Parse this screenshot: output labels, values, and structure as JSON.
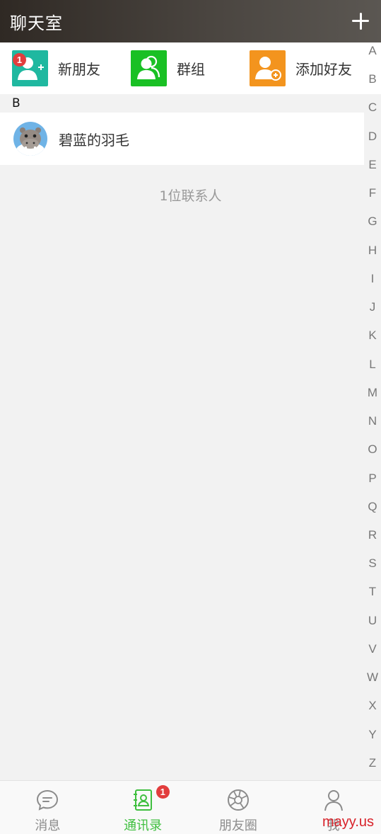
{
  "header": {
    "title": "聊天室",
    "add_icon": "plus-icon"
  },
  "shortcuts": [
    {
      "label": "新朋友",
      "icon": "new-friend-icon",
      "color": "#1fb8a0",
      "badge": "1"
    },
    {
      "label": "群组",
      "icon": "group-icon",
      "color": "#19c024"
    },
    {
      "label": "添加好友",
      "icon": "add-friend-icon",
      "color": "#f3941e"
    }
  ],
  "section": {
    "letter": "B"
  },
  "contacts": [
    {
      "name": "碧蓝的羽毛",
      "avatar": "hippo-avatar"
    }
  ],
  "contact_count": "1位联系人",
  "index_letters": [
    "A",
    "B",
    "C",
    "D",
    "E",
    "F",
    "G",
    "H",
    "I",
    "J",
    "K",
    "L",
    "M",
    "N",
    "O",
    "P",
    "Q",
    "R",
    "S",
    "T",
    "U",
    "V",
    "W",
    "X",
    "Y",
    "Z"
  ],
  "tabs": [
    {
      "label": "消息",
      "icon": "chat-icon",
      "active": false
    },
    {
      "label": "通讯录",
      "icon": "contacts-icon",
      "active": true,
      "badge": "1"
    },
    {
      "label": "朋友圈",
      "icon": "moments-icon",
      "active": false
    },
    {
      "label": "我",
      "icon": "profile-icon",
      "active": false
    }
  ],
  "watermark": "mayy.us",
  "colors": {
    "accent": "#3fbf3f",
    "badge": "#e23d3d",
    "inactive": "#8c8c8c"
  }
}
